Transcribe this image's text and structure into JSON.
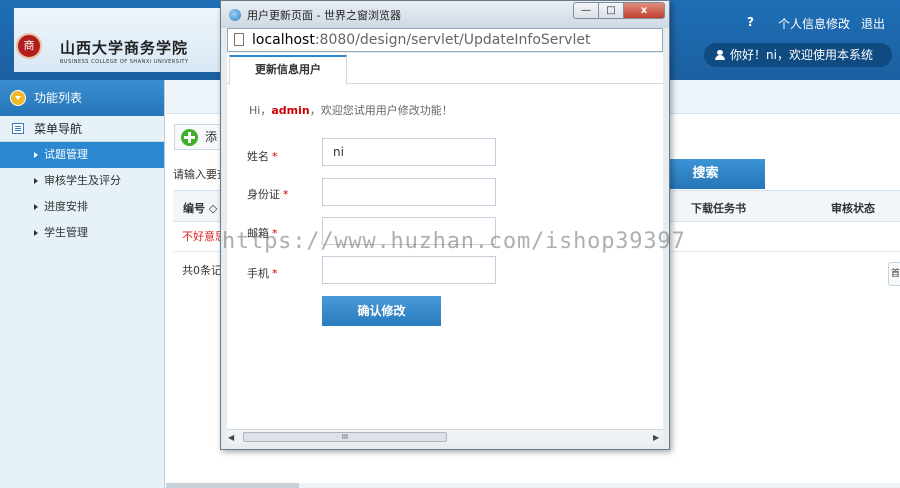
{
  "header": {
    "school_name": "山西大学商务学院",
    "school_name_en": "BUSINESS COLLEGE OF SHANXI UNIVERSITY",
    "seal_text": "商",
    "help_label": "?",
    "profile_link": "个人信息修改",
    "logout_link": "退出",
    "greeting": "你好！ni，欢迎使用本系统"
  },
  "sidebar": {
    "title": "功能列表",
    "menu_nav": "菜单导航",
    "items": [
      {
        "label": "试题管理",
        "active": true
      },
      {
        "label": "审核学生及评分",
        "active": false
      },
      {
        "label": "进度安排",
        "active": false
      },
      {
        "label": "学生管理",
        "active": false
      }
    ]
  },
  "main": {
    "add_button": "添",
    "input_hint": "请输入要查",
    "search_button": "搜索",
    "table": {
      "columns": [
        "编号 ◇",
        "下载任务书",
        "审核状态"
      ],
      "empty_message": "不好意思"
    },
    "total_count": "共0条记录",
    "page_stub": "首"
  },
  "popup": {
    "window_title": "用户更新页面 - 世界之窗浏览器",
    "window_buttons": {
      "minimize": "—",
      "maximize": "□",
      "close": "x"
    },
    "address_host": "localhost",
    "address_rest": ":8080/design/servlet/UpdateInfoServlet",
    "tab": "更新信息用户",
    "welcome_prefix": "Hi，",
    "welcome_user": "admin",
    "welcome_suffix": "，欢迎您试用用户修改功能！",
    "form": {
      "name_label": "姓名",
      "name_value": "ni",
      "id_label": "身份证",
      "id_value": "",
      "email_label": "邮箱",
      "email_value": "",
      "phone_label": "手机",
      "phone_value": "",
      "required_mark": "*",
      "confirm_button": "确认修改"
    },
    "scrollbar": {
      "left_arrow": "◀",
      "right_arrow": "▶",
      "grip": "III"
    }
  },
  "watermark": "https://www.huzhan.com/ishop39397"
}
